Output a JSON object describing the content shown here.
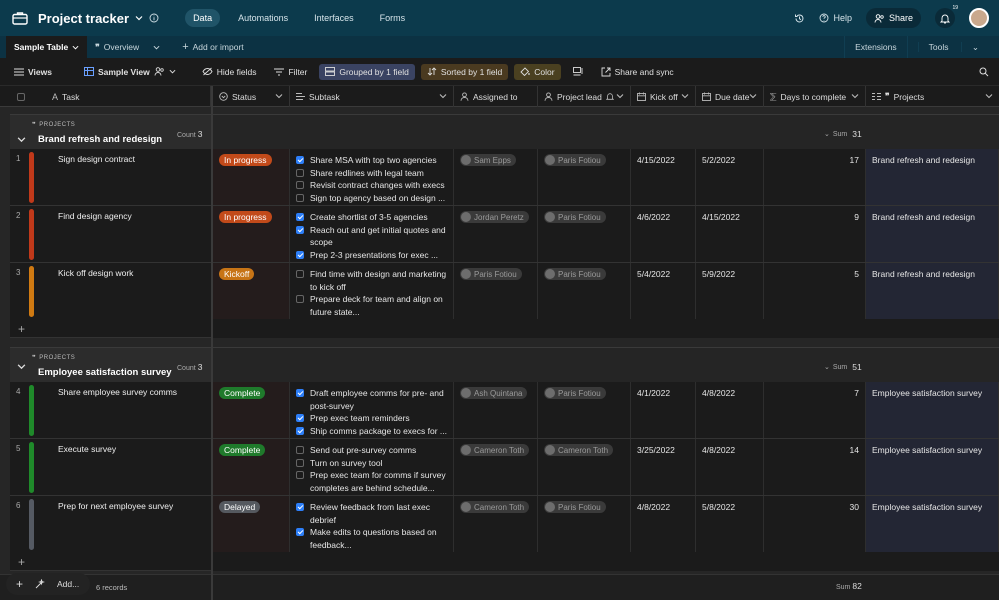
{
  "app": {
    "title": "Project tracker"
  },
  "nav": [
    "Data",
    "Automations",
    "Interfaces",
    "Forms"
  ],
  "topright": {
    "help": "Help",
    "share": "Share",
    "notif_count": "19"
  },
  "tabs": {
    "active": "Sample Table",
    "overview": "Overview",
    "add": "Add or import",
    "extensions": "Extensions",
    "tools": "Tools"
  },
  "toolbar": {
    "views": "Views",
    "view_name": "Sample View",
    "hide": "Hide fields",
    "filter": "Filter",
    "group": "Grouped by 1 field",
    "sort": "Sorted by 1 field",
    "color": "Color",
    "share": "Share and sync"
  },
  "columns": {
    "task": "Task",
    "status": "Status",
    "subtask": "Subtask",
    "assigned": "Assigned to",
    "lead": "Project lead",
    "kickoff": "Kick off",
    "due": "Due date",
    "days": "Days to complete",
    "projects": "Projects"
  },
  "colors": {
    "in_progress": "#c24a1a",
    "kickoff": "#c77416",
    "complete": "#1f7a2b",
    "delayed": "#55595f",
    "strip_red": "#c0391a",
    "strip_orange": "#d07a12",
    "strip_green": "#1f8a2a",
    "strip_gray": "#555a63"
  },
  "groups": [
    {
      "label": "PROJECTS",
      "name": "Brand refresh and redesign",
      "count_label": "Count",
      "count": "3",
      "sum_label": "Sum",
      "sum": "31",
      "rows": [
        {
          "n": "1",
          "task": "Sign design contract",
          "status": "In progress",
          "status_color": "#c24a1a",
          "strip": "#c0391a",
          "subtasks": [
            {
              "t": "Share MSA with top two agencies",
              "c": true
            },
            {
              "t": "Share redlines with legal team",
              "c": false
            },
            {
              "t": "Revisit contract changes with execs",
              "c": false
            },
            {
              "t": "Sign top agency based on design ...",
              "c": false
            }
          ],
          "assigned": "Sam Epps",
          "lead": "Paris Fotiou",
          "kickoff": "4/15/2022",
          "due": "5/2/2022",
          "days": "17",
          "project": "Brand refresh and redesign"
        },
        {
          "n": "2",
          "task": "Find design agency",
          "status": "In progress",
          "status_color": "#c24a1a",
          "strip": "#c0391a",
          "subtasks": [
            {
              "t": "Create shortlist of 3-5 agencies",
              "c": true
            },
            {
              "t": "Reach out and get initial quotes and scope",
              "c": true
            },
            {
              "t": "Prep 2-3 presentations for exec ...",
              "c": true
            }
          ],
          "assigned": "Jordan Peretz",
          "lead": "Paris Fotiou",
          "kickoff": "4/6/2022",
          "due": "4/15/2022",
          "days": "9",
          "project": "Brand refresh and redesign"
        },
        {
          "n": "3",
          "task": "Kick off design work",
          "status": "Kickoff",
          "status_color": "#c77416",
          "strip": "#d07a12",
          "subtasks": [
            {
              "t": "Find time with design and marketing to kick off",
              "c": false
            },
            {
              "t": "Prepare deck for team and align on future state...",
              "c": false
            }
          ],
          "assigned": "Paris Fotiou",
          "lead": "Paris Fotiou",
          "kickoff": "5/4/2022",
          "due": "5/9/2022",
          "days": "5",
          "project": "Brand refresh and redesign"
        }
      ]
    },
    {
      "label": "PROJECTS",
      "name": "Employee satisfaction survey",
      "count_label": "Count",
      "count": "3",
      "sum_label": "Sum",
      "sum": "51",
      "rows": [
        {
          "n": "4",
          "task": "Share employee survey comms",
          "status": "Complete",
          "status_color": "#1f7a2b",
          "strip": "#1f8a2a",
          "subtasks": [
            {
              "t": "Draft employee comms for pre- and post-survey",
              "c": true
            },
            {
              "t": "Prep exec team reminders",
              "c": true
            },
            {
              "t": "Ship comms package to execs for ...",
              "c": true
            }
          ],
          "assigned": "Ash Quintana",
          "lead": "Paris Fotiou",
          "kickoff": "4/1/2022",
          "due": "4/8/2022",
          "days": "7",
          "project": "Employee satisfaction survey"
        },
        {
          "n": "5",
          "task": "Execute survey",
          "status": "Complete",
          "status_color": "#1f7a2b",
          "strip": "#1f8a2a",
          "subtasks": [
            {
              "t": "Send out pre-survey comms",
              "c": false
            },
            {
              "t": "Turn on survey tool",
              "c": false
            },
            {
              "t": "Prep exec team for comms if survey completes are behind schedule...",
              "c": false
            }
          ],
          "assigned": "Cameron Toth",
          "lead": "Cameron Toth",
          "kickoff": "3/25/2022",
          "due": "4/8/2022",
          "days": "14",
          "project": "Employee satisfaction survey"
        },
        {
          "n": "6",
          "task": "Prep for next employee survey",
          "status": "Delayed",
          "status_color": "#55595f",
          "strip": "#555a63",
          "subtasks": [
            {
              "t": "Review feedback from last exec debrief",
              "c": true
            },
            {
              "t": "Make edits to questions based on feedback...",
              "c": true
            }
          ],
          "assigned": "Cameron Toth",
          "lead": "Paris Fotiou",
          "kickoff": "4/8/2022",
          "due": "5/8/2022",
          "days": "30",
          "project": "Employee satisfaction survey"
        }
      ]
    }
  ],
  "footer": {
    "add": "Add...",
    "records": "6 records",
    "sum_label": "Sum",
    "sum": "82"
  }
}
